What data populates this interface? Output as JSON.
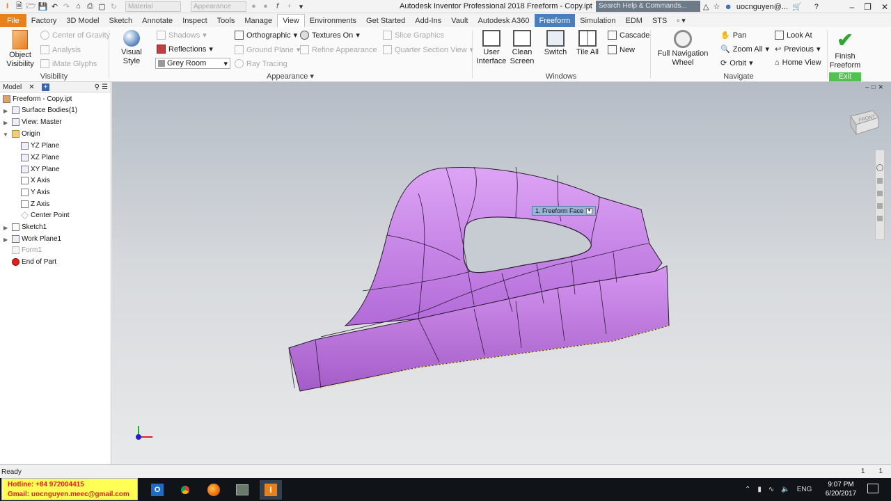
{
  "titlebar": {
    "material": "Material",
    "appearance": "Appearance",
    "title": "Autodesk Inventor Professional 2018    Freeform - Copy.ipt",
    "search_placeholder": "Search Help & Commands...",
    "user": "uocnguyen@...",
    "minimize": "–",
    "restore": "❐",
    "close": "✕"
  },
  "tabs": [
    "File",
    "Factory",
    "3D Model",
    "Sketch",
    "Annotate",
    "Inspect",
    "Tools",
    "Manage",
    "View",
    "Environments",
    "Get Started",
    "Add-Ins",
    "Vault",
    "Autodesk A360",
    "Freeform",
    "Simulation",
    "EDM",
    "STS"
  ],
  "ribbon": {
    "visibility": {
      "label": "Visibility",
      "object_visibility": "Object Visibility",
      "center_of_gravity": "Center of Gravity",
      "analysis": "Analysis",
      "imate_glyphs": "iMate Glyphs"
    },
    "appearance": {
      "label": "Appearance",
      "visual_style": "Visual Style",
      "shadows": "Shadows",
      "reflections": "Reflections",
      "grey_room": "Grey Room",
      "orthographic": "Orthographic",
      "ground_plane": "Ground Plane",
      "ray_tracing": "Ray Tracing",
      "textures_on": "Textures On",
      "refine_appearance": "Refine Appearance",
      "slice_graphics": "Slice Graphics",
      "quarter_section_view": "Quarter Section View"
    },
    "windows": {
      "label": "Windows",
      "user_interface": "User Interface",
      "clean_screen": "Clean Screen",
      "switch": "Switch",
      "tile_all": "Tile All",
      "cascade": "Cascade",
      "new": "New"
    },
    "navigate": {
      "label": "Navigate",
      "full_navigation_wheel": "Full Navigation Wheel",
      "pan": "Pan",
      "zoom_all": "Zoom All",
      "orbit": "Orbit",
      "look_at": "Look At",
      "previous": "Previous",
      "home_view": "Home View"
    },
    "exit": {
      "label": "Exit",
      "finish_freeform": "Finish Freeform"
    }
  },
  "browser": {
    "tab": "Model",
    "items": [
      {
        "label": "Freeform - Copy.ipt"
      },
      {
        "label": "Surface Bodies(1)"
      },
      {
        "label": "View: Master"
      },
      {
        "label": "Origin"
      },
      {
        "label": "YZ Plane"
      },
      {
        "label": "XZ Plane"
      },
      {
        "label": "XY Plane"
      },
      {
        "label": "X Axis"
      },
      {
        "label": "Y Axis"
      },
      {
        "label": "Z Axis"
      },
      {
        "label": "Center Point"
      },
      {
        "label": "Sketch1"
      },
      {
        "label": "Work Plane1"
      },
      {
        "label": "Form1"
      },
      {
        "label": "End of Part"
      }
    ]
  },
  "viewport": {
    "viewcube_face": "FRONT",
    "tooltip": "1. Freeform Face"
  },
  "status": {
    "text": "Ready",
    "num1": "1",
    "num2": "1"
  },
  "taskbar": {
    "hotline": "Hotline: +84 972004415",
    "gmail": "Gmail: uocnguyen.meec@gmail.com",
    "lang": "ENG",
    "time": "9:07 PM",
    "date": "6/20/2017"
  }
}
